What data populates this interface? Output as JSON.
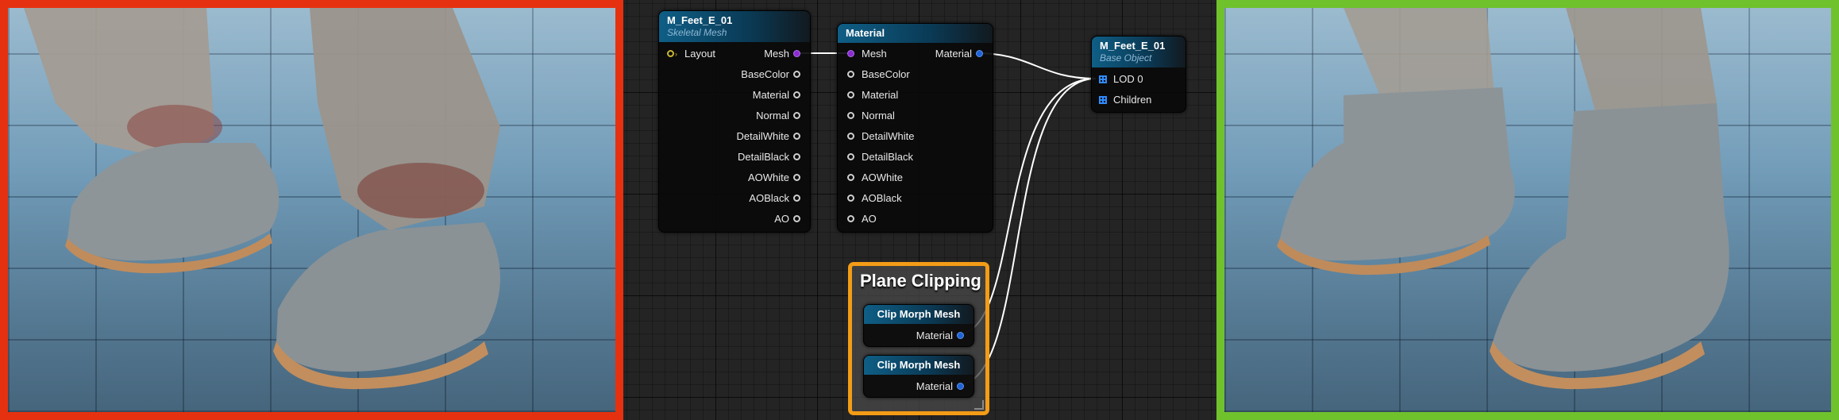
{
  "viewports": {
    "left": {
      "border_color": "#e53110"
    },
    "right": {
      "border_color": "#6fc22c"
    }
  },
  "graph": {
    "skeletal_mesh_node": {
      "title": "M_Feet_E_01",
      "subtitle": "Skeletal Mesh",
      "inputs": [
        "Layout"
      ],
      "outputs": [
        "Mesh",
        "BaseColor",
        "Material",
        "Normal",
        "DetailWhite",
        "DetailBlack",
        "AOWhite",
        "AOBlack",
        "AO"
      ]
    },
    "material_node": {
      "title": "Material",
      "inputs": [
        "Mesh",
        "BaseColor",
        "Material",
        "Normal",
        "DetailWhite",
        "DetailBlack",
        "AOWhite",
        "AOBlack",
        "AO"
      ],
      "output": "Material"
    },
    "base_object_node": {
      "title": "M_Feet_E_01",
      "subtitle": "Base Object",
      "inputs": [
        "LOD 0",
        "Children"
      ]
    },
    "comment": {
      "title": "Plane Clipping",
      "color": "#f39c16"
    },
    "clip_nodes": [
      {
        "title": "Clip Morph Mesh",
        "output": "Material"
      },
      {
        "title": "Clip Morph Mesh",
        "output": "Material"
      }
    ]
  }
}
